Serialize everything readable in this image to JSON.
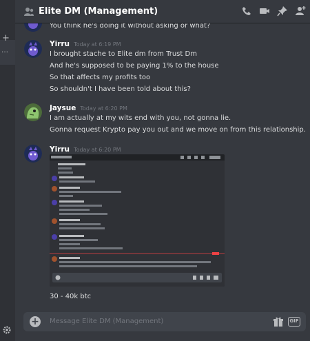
{
  "header": {
    "title": "Elite DM (Management)",
    "icons": [
      "group-dm-icon",
      "voice-call-icon",
      "video-call-icon",
      "pin-icon",
      "add-member-icon"
    ]
  },
  "messages": [
    {
      "author": "",
      "timestamp": "",
      "lines": [
        "You think he's doing it without asking or what?"
      ]
    },
    {
      "author": "Yirru",
      "timestamp": "Today at 6:19 PM",
      "lines": [
        "I brought stache to Elite dm from Trust Dm",
        "And he's supposed to be paying 1% to the house",
        "So that affects my profits too",
        "So shouldn't I have been told about this?"
      ]
    },
    {
      "author": "Jaysue",
      "timestamp": "Today at 6:20 PM",
      "lines": [
        "I am actually at my wits end with you, not gonna lie.",
        "Gonna request Krypto pay you out and we move on from this relationship."
      ]
    },
    {
      "author": "Yirru",
      "timestamp": "Today at 6:20 PM",
      "lines": [
        "30 - 40k btc"
      ]
    }
  ],
  "composer": {
    "placeholder": "Message Elite DM (Management)",
    "gif_label": "GIF"
  },
  "colors": {
    "background": "#36393f",
    "sidebar": "#2f3136",
    "composer": "#40444b",
    "yirru_avatar": "#1e2b55",
    "jaysue_avatar": "#8ec56f"
  }
}
